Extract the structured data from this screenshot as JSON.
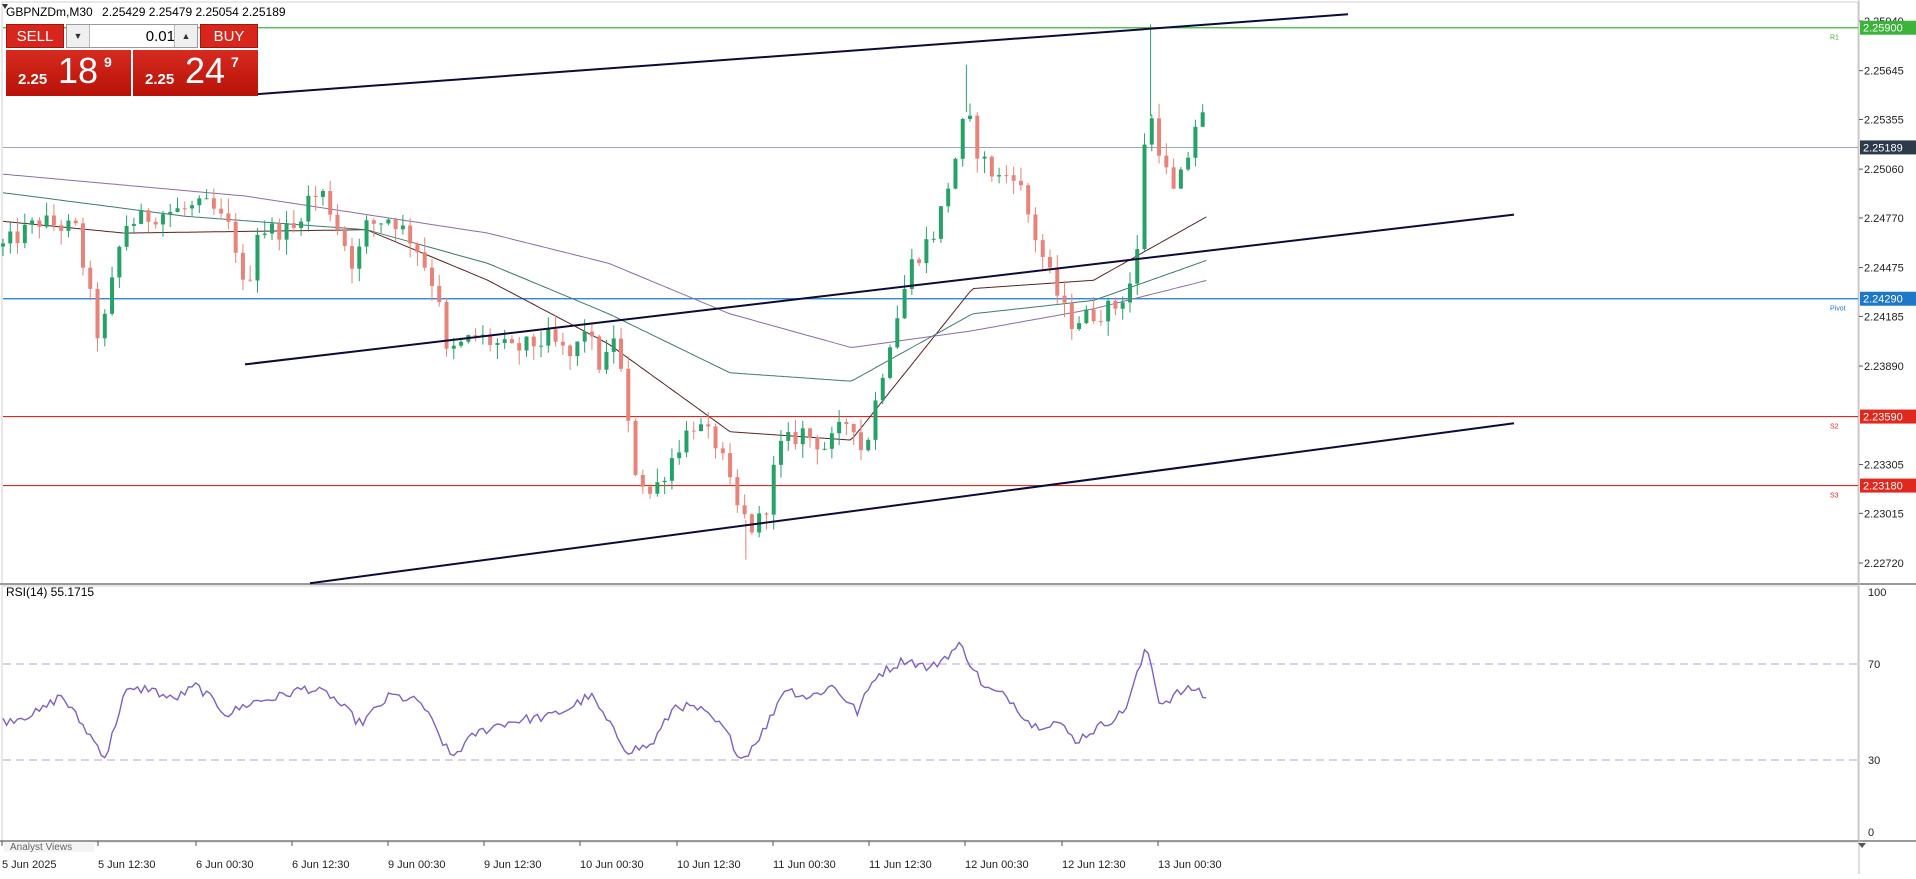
{
  "header": {
    "symbol_tf": "GBPNZDm,M30",
    "ohlc": "2.25429 2.25479 2.25054 2.25189"
  },
  "trade_panel": {
    "sell_label": "SELL",
    "buy_label": "BUY",
    "lot": "0.01",
    "sell_prefix": "2.25",
    "sell_big": "18",
    "sell_sup": "9",
    "buy_prefix": "2.25",
    "buy_big": "24",
    "buy_sup": "7"
  },
  "price_axis": {
    "ticks": [
      "2.25940",
      "2.25645",
      "2.25355",
      "2.25060",
      "2.24770",
      "2.24475",
      "2.24185",
      "2.23890",
      "2.23305",
      "2.23015",
      "2.22720"
    ],
    "tick_values": [
      2.2594,
      2.25645,
      2.25355,
      2.2506,
      2.2477,
      2.24475,
      2.24185,
      2.2389,
      2.23305,
      2.23015,
      2.2272
    ]
  },
  "levels": [
    {
      "label": "2.25900",
      "value": 2.259,
      "color": "#3cb43c",
      "tag": "R1"
    },
    {
      "label": "2.24290",
      "value": 2.2429,
      "color": "#1e78c8",
      "tag": "Pivot"
    },
    {
      "label": "2.23590",
      "value": 2.2359,
      "color": "#e0281e",
      "tag": "S2"
    },
    {
      "label": "2.23180",
      "value": 2.2318,
      "color": "#e0281e",
      "tag": "S3"
    }
  ],
  "current_price": {
    "label": "2.25189",
    "value": 2.25189,
    "color": "#2b3b4b"
  },
  "rsi": {
    "label": "RSI(14) 55.1715",
    "levels": [
      "100",
      "70",
      "30",
      "0"
    ]
  },
  "time_axis": [
    "5 Jun 2025",
    "5 Jun 12:30",
    "6 Jun 00:30",
    "6 Jun 12:30",
    "9 Jun 00:30",
    "9 Jun 12:30",
    "10 Jun 00:30",
    "10 Jun 12:30",
    "11 Jun 00:30",
    "11 Jun 12:30",
    "12 Jun 00:30",
    "12 Jun 12:30",
    "13 Jun 00:30"
  ],
  "bottom_tab": "Analyst Views",
  "colors": {
    "bull": "#26a269",
    "bear": "#e8837a",
    "rsi_line": "#7d60c8",
    "trendline": "#0b0b3b",
    "ma_fast": "#5a2222",
    "ma_mid": "#3d7a6e",
    "ma_slow": "#8a6da6"
  },
  "chart_data": {
    "type": "candlestick",
    "timeframe": "M30",
    "symbol": "GBPNZDm",
    "ylim": [
      2.226,
      2.2598
    ],
    "close_anchors": [
      [
        0,
        2.246
      ],
      [
        30,
        2.2475
      ],
      [
        60,
        2.247
      ],
      [
        80,
        2.2402
      ],
      [
        100,
        2.2473
      ],
      [
        130,
        2.248
      ],
      [
        170,
        2.2484
      ],
      [
        190,
        2.2468
      ],
      [
        200,
        2.2428
      ],
      [
        210,
        2.247
      ],
      [
        240,
        2.247
      ],
      [
        250,
        2.2488
      ],
      [
        265,
        2.2491
      ],
      [
        290,
        2.2448
      ],
      [
        300,
        2.2472
      ],
      [
        320,
        2.2478
      ],
      [
        340,
        2.2462
      ],
      [
        360,
        2.243
      ],
      [
        365,
        2.2395
      ],
      [
        390,
        2.2407
      ],
      [
        420,
        2.2398
      ],
      [
        450,
        2.2405
      ],
      [
        470,
        2.2393
      ],
      [
        480,
        2.2412
      ],
      [
        495,
        2.2385
      ],
      [
        505,
        2.241
      ],
      [
        512,
        2.2375
      ],
      [
        520,
        2.233
      ],
      [
        535,
        2.2312
      ],
      [
        545,
        2.2325
      ],
      [
        560,
        2.2345
      ],
      [
        570,
        2.2355
      ],
      [
        590,
        2.2342
      ],
      [
        605,
        2.2305
      ],
      [
        618,
        2.2293
      ],
      [
        628,
        2.23
      ],
      [
        640,
        2.234
      ],
      [
        660,
        2.235
      ],
      [
        680,
        2.234
      ],
      [
        700,
        2.236
      ],
      [
        710,
        2.2335
      ],
      [
        730,
        2.24
      ],
      [
        750,
        2.245
      ],
      [
        770,
        2.247
      ],
      [
        785,
        2.251
      ],
      [
        795,
        2.254
      ],
      [
        805,
        2.2515
      ],
      [
        820,
        2.25
      ],
      [
        835,
        2.2505
      ],
      [
        850,
        2.247
      ],
      [
        865,
        2.244
      ],
      [
        880,
        2.2415
      ],
      [
        900,
        2.242
      ],
      [
        920,
        2.2425
      ],
      [
        935,
        2.2445
      ],
      [
        944,
        2.2545
      ],
      [
        952,
        2.2525
      ],
      [
        965,
        2.249
      ],
      [
        975,
        2.2505
      ],
      [
        988,
        2.2545
      ],
      [
        994,
        2.25189
      ]
    ],
    "extremes": [
      {
        "label": "high",
        "x_index": 947,
        "value": 2.2592
      },
      {
        "label": "high",
        "x_index": 795,
        "value": 2.2568
      },
      {
        "label": "low",
        "x_index": 613,
        "value": 2.2274
      }
    ],
    "moving_averages": [
      {
        "name": "MA fast",
        "anchors": [
          [
            0,
            2.2475
          ],
          [
            100,
            2.2468
          ],
          [
            300,
            2.247
          ],
          [
            400,
            2.244
          ],
          [
            500,
            2.2402
          ],
          [
            600,
            2.235
          ],
          [
            700,
            2.2345
          ],
          [
            800,
            2.2435
          ],
          [
            900,
            2.244
          ],
          [
            994,
            2.2478
          ]
        ]
      },
      {
        "name": "MA mid",
        "anchors": [
          [
            0,
            2.2492
          ],
          [
            150,
            2.2478
          ],
          [
            300,
            2.247
          ],
          [
            400,
            2.245
          ],
          [
            500,
            2.242
          ],
          [
            600,
            2.2385
          ],
          [
            700,
            2.238
          ],
          [
            800,
            2.242
          ],
          [
            900,
            2.2428
          ],
          [
            994,
            2.2452
          ]
        ]
      },
      {
        "name": "MA slow",
        "anchors": [
          [
            0,
            2.2503
          ],
          [
            200,
            2.249
          ],
          [
            400,
            2.2468
          ],
          [
            500,
            2.245
          ],
          [
            600,
            2.242
          ],
          [
            700,
            2.24
          ],
          [
            800,
            2.241
          ],
          [
            900,
            2.2423
          ],
          [
            994,
            2.244
          ]
        ]
      }
    ],
    "trendlines": [
      {
        "x1": 245,
        "y1": 2.255,
        "x2": 1348,
        "y2": 2.2598
      },
      {
        "x1": 245,
        "y1": 2.239,
        "x2": 1514,
        "y2": 2.2479
      },
      {
        "x1": 310,
        "y1": 2.226,
        "x2": 1514,
        "y2": 2.2355
      }
    ],
    "rsi_anchors": [
      [
        0,
        46
      ],
      [
        30,
        50
      ],
      [
        48,
        57
      ],
      [
        65,
        45
      ],
      [
        85,
        31
      ],
      [
        100,
        58
      ],
      [
        120,
        60
      ],
      [
        140,
        55
      ],
      [
        160,
        61
      ],
      [
        185,
        49
      ],
      [
        205,
        54
      ],
      [
        225,
        56
      ],
      [
        250,
        60
      ],
      [
        270,
        57
      ],
      [
        295,
        45
      ],
      [
        320,
        57
      ],
      [
        345,
        54
      ],
      [
        370,
        31
      ],
      [
        390,
        41
      ],
      [
        410,
        45
      ],
      [
        430,
        47
      ],
      [
        450,
        48
      ],
      [
        465,
        51
      ],
      [
        485,
        57
      ],
      [
        500,
        45
      ],
      [
        515,
        34
      ],
      [
        535,
        36
      ],
      [
        555,
        53
      ],
      [
        575,
        51
      ],
      [
        595,
        43
      ],
      [
        610,
        30
      ],
      [
        630,
        44
      ],
      [
        645,
        60
      ],
      [
        665,
        56
      ],
      [
        685,
        61
      ],
      [
        705,
        50
      ],
      [
        720,
        65
      ],
      [
        745,
        72
      ],
      [
        765,
        68
      ],
      [
        790,
        78
      ],
      [
        810,
        60
      ],
      [
        830,
        56
      ],
      [
        850,
        44
      ],
      [
        870,
        46
      ],
      [
        885,
        38
      ],
      [
        905,
        44
      ],
      [
        925,
        50
      ],
      [
        944,
        77
      ],
      [
        955,
        53
      ],
      [
        970,
        58
      ],
      [
        985,
        60
      ],
      [
        994,
        55
      ]
    ]
  }
}
